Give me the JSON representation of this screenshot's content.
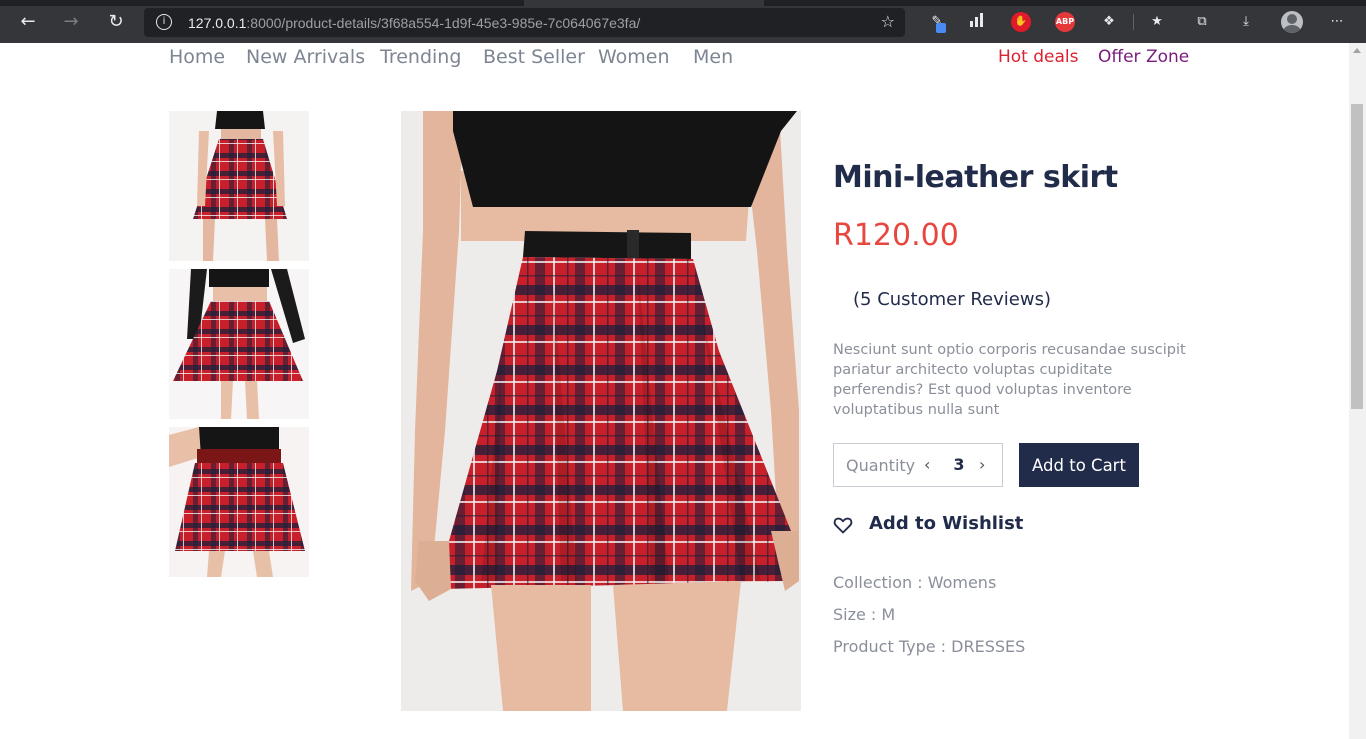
{
  "browser": {
    "url_host": "127.0.0.1",
    "url_rest": ":8000/product-details/3f68a554-1d9f-45e3-985e-7c064067e3fa/",
    "back_icon": "arrow-left-icon",
    "forward_icon": "arrow-right-icon",
    "reload_icon": "reload-icon",
    "extensions": [
      "pen-icon",
      "chart-icon",
      "stop-hand-icon",
      "abp-icon",
      "puzzle-icon"
    ],
    "abp_label": "ABP"
  },
  "nav": {
    "items": [
      "Home",
      "New Arrivals",
      "Trending",
      "Best Seller",
      "Women",
      "Men"
    ],
    "hot_deals": "Hot deals",
    "offer_zone": "Offer Zone"
  },
  "product": {
    "title": "Mini-leather skirt",
    "price": "R120.00",
    "reviews": "(5 Customer Reviews)",
    "description": "Nesciunt sunt optio corporis recusandae suscipit pariatur architecto voluptas cupiditate perferendis? Est quod voluptas inventore voluptatibus nulla sunt",
    "quantity_label": "Quantity",
    "quantity_value": "3",
    "add_to_cart": "Add to Cart",
    "add_to_wishlist": "Add to Wishlist",
    "collection": "Collection : Womens",
    "size": "Size : M",
    "product_type": "Product Type : DRESSES"
  },
  "colors": {
    "navy": "#212b4a",
    "price_red": "#e8473f",
    "hot_red": "#d9232e",
    "offer_purple": "#7a1a7d",
    "plaid_red": "#c8202a"
  }
}
